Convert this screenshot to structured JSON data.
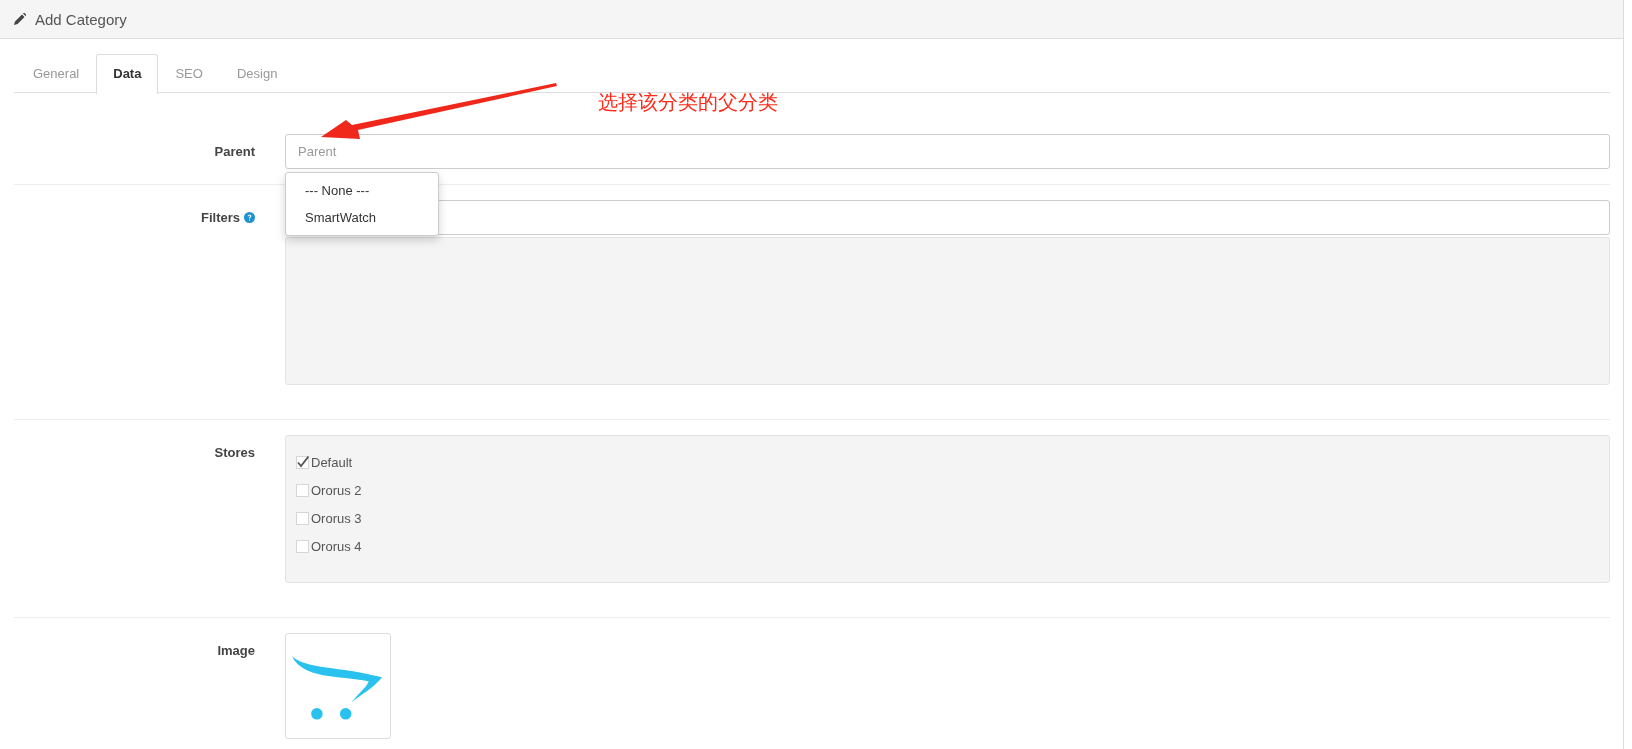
{
  "header": {
    "title": "Add Category"
  },
  "tabs": [
    {
      "label": "General",
      "selected": false
    },
    {
      "label": "Data",
      "selected": true
    },
    {
      "label": "SEO",
      "selected": false
    },
    {
      "label": "Design",
      "selected": false
    }
  ],
  "annotation": {
    "text": "选择该分类的父分类"
  },
  "parent": {
    "label": "Parent",
    "placeholder": "Parent",
    "dropdown": [
      {
        "label": "--- None ---"
      },
      {
        "label": "SmartWatch"
      }
    ]
  },
  "filters": {
    "label": "Filters"
  },
  "stores": {
    "label": "Stores",
    "items": [
      {
        "label": "Default",
        "checked": true
      },
      {
        "label": "Ororus 2",
        "checked": false
      },
      {
        "label": "Ororus 3",
        "checked": false
      },
      {
        "label": "Ororus 4",
        "checked": false
      }
    ]
  },
  "image": {
    "label": "Image"
  }
}
